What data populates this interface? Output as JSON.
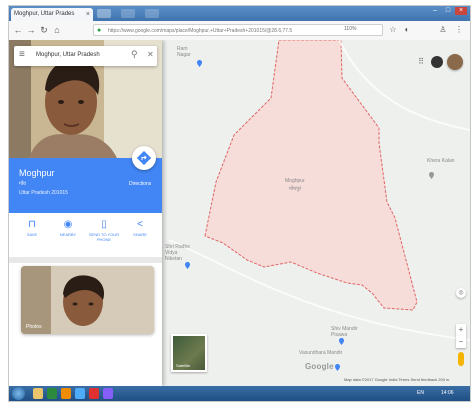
{
  "browser": {
    "tab_title": "Moghpur, Uttar Prades",
    "tab_close": "×",
    "url": "https://www.google.com/maps/place/Moghpur,+Uttar+Pradesh+201015/@28.6,77.5",
    "zoom": "110%",
    "lock_icon": "lock-icon"
  },
  "search": {
    "query": "Moghpur, Uttar Pradesh",
    "menu_icon": "menu-icon",
    "search_icon": "search-icon",
    "close_icon": "close-icon"
  },
  "place": {
    "name": "Moghpur",
    "type": "गाँव",
    "address": "Uttar Pradesh 201015",
    "directions_label": "Directions"
  },
  "actions": [
    {
      "label": "SAVE",
      "icon": "bookmark-icon"
    },
    {
      "label": "NEARBY",
      "icon": "nearby-icon"
    },
    {
      "label": "SEND TO YOUR PHONE",
      "icon": "phone-icon"
    },
    {
      "label": "SHARE",
      "icon": "share-icon"
    }
  ],
  "photos": {
    "card_label": "Photos"
  },
  "map": {
    "area_label": "Moghpur",
    "area_label_local": "मोघपुर",
    "places": [
      {
        "name": "Ram Nagar"
      },
      {
        "name": "Khera Kalan"
      },
      {
        "name": "Shri Radhe Vidya Niketan"
      },
      {
        "name": "Shiv Mandir Pisawa"
      },
      {
        "name": "Vasundhara Mandir"
      }
    ],
    "satellite_label": "Satellite",
    "google_logo": "Google",
    "footer": "Map data ©2017 Google  India  Terms  Send feedback  200 m",
    "accent": "#4285f4",
    "boundary_color": "#e06666"
  },
  "taskbar": {
    "time": "14:06",
    "lang": "EN"
  }
}
